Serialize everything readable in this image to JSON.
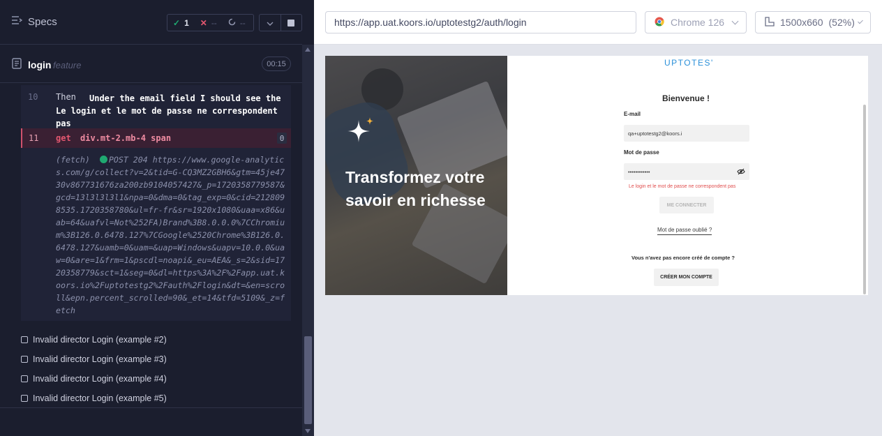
{
  "colors": {
    "reporter_bg": "#1b1e2e",
    "pass": "#1fa971",
    "fail": "#e45770",
    "link": "#2b90d9"
  },
  "header": {
    "specs_label": "Specs",
    "passed_count": "1",
    "failed_count": "--",
    "pending_count": "--"
  },
  "spec": {
    "name": "login",
    "ext": "feature",
    "duration": "00:15"
  },
  "commands": {
    "row10": {
      "number": "10",
      "keyword": "Then",
      "message": "Under the email field I should see the Le login et le mot de passe ne correspondent pas"
    },
    "row11": {
      "number": "11",
      "command": "get",
      "selector": "div.mt-2.mb-4 span",
      "count": "0"
    },
    "fetch": {
      "prefix": "(fetch)",
      "text": "POST 204 https://www.google-analytics.com/g/collect?v=2&tid=G-CQ3MZ2GBH6&gtm=45je4730v867731676za200zb9104057427&_p=1720358779587&gcd=13l3l3l3l1&npa=0&dma=0&tag_exp=0&cid=2128098535.1720358780&ul=fr-fr&sr=1920x1080&uaa=x86&uab=64&uafvl=Not%252FA)Brand%3B8.0.0.0%7CChromium%3B126.0.6478.127%7CGoogle%2520Chrome%3B126.0.6478.127&uamb=0&uam=&uap=Windows&uapv=10.0.0&uaw=0&are=1&frm=1&pscdl=noapi&_eu=AEA&_s=2&sid=1720358779&sct=1&seg=0&dl=https%3A%2F%2Fapp.uat.koors.io%2Fuptotestg2%2Fauth%2Flogin&dt=&en=scroll&epn.percent_scrolled=90&_et=14&tfd=5109&_z=fetch"
    }
  },
  "examples": [
    {
      "label": "Invalid director Login (example #2)"
    },
    {
      "label": "Invalid director Login (example #3)"
    },
    {
      "label": "Invalid director Login (example #4)"
    },
    {
      "label": "Invalid director Login (example #5)"
    }
  ],
  "aut": {
    "url": "https://app.uat.koors.io/uptotestg2/auth/login",
    "browser": "Chrome 126",
    "viewport": "1500x660",
    "zoom": "(52%)"
  },
  "page": {
    "brand": "UPTOTES'",
    "hero_text": "Transformez votre savoir en richesse",
    "welcome": "Bienvenue !",
    "email_label": "E-mail",
    "email_value": "qa+uptotestg2@koors.i",
    "password_label": "Mot de passe",
    "password_value": "••••••••••••",
    "error": "Le login et le mot de passe ne correspondent pas",
    "connect_button": "ME CONNECTER",
    "forgot": "Mot de passe oublié ?",
    "no_account": "Vous n'avez pas encore créé de compte ?",
    "create_button": "CRÉER MON COMPTE"
  }
}
